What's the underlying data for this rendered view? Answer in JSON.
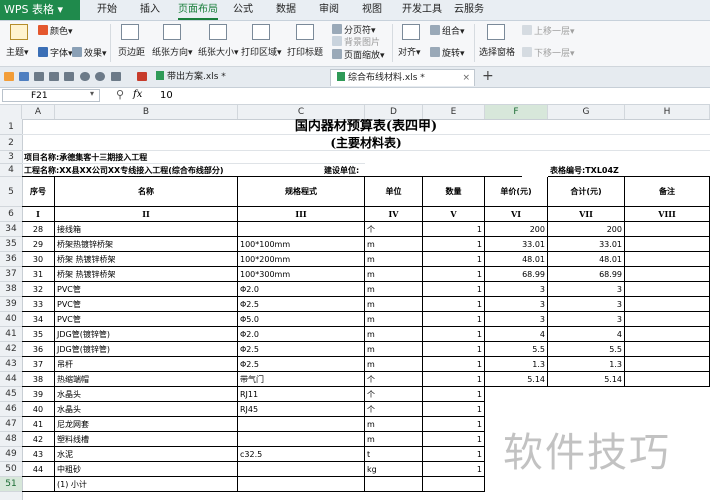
{
  "app_button": "WPS 表格",
  "ribbon_tabs": [
    "开始",
    "插入",
    "页面布局",
    "公式",
    "数据",
    "审阅",
    "视图",
    "开发工具",
    "云服务"
  ],
  "ribbon": {
    "theme": "主题",
    "colors": "颜色",
    "fonts": "字体",
    "effects": "效果",
    "margins": "页边距",
    "orientation": "纸张方向",
    "size": "纸张大小",
    "print_area": "打印区域",
    "print_titles": "打印标题",
    "page_break": "分页符",
    "bg_image": "背景图片",
    "page_zoom": "页面缩放",
    "align": "对齐",
    "group": "组合",
    "rotate": "旋转",
    "select_pane": "选择窗格",
    "bring_forward": "上移一层",
    "send_backward": "下移一层"
  },
  "doc_tabs": [
    {
      "label": "带出方案.xls *"
    },
    {
      "label": "综合布线材料.xls *"
    }
  ],
  "formula_bar": {
    "cell_ref": "F21",
    "fx": "fx",
    "value": "10"
  },
  "columns": [
    "A",
    "B",
    "C",
    "D",
    "E",
    "F",
    "G",
    "H"
  ],
  "row_numbers": [
    "1",
    "2",
    "3",
    "4",
    "5",
    "6",
    "34",
    "35",
    "36",
    "37",
    "38",
    "39",
    "40",
    "41",
    "42",
    "43",
    "44",
    "45",
    "46",
    "47",
    "48",
    "49",
    "50",
    "51"
  ],
  "sheet": {
    "title": "国内器材预算表(表四甲)",
    "subtitle": "(主要材料表)",
    "project_name": "项目名称:承德集客十三期接入工程",
    "work_name": "工程名称:XX县XX公司XX专线接入工程(综合布线部分)",
    "build_unit": "建设单位:",
    "table_no": "表格编号:TXL04Z",
    "headers": [
      "序号",
      "名称",
      "规格程式",
      "单位",
      "数量",
      "单价(元)",
      "合计(元)",
      "备注"
    ],
    "roman": [
      "I",
      "II",
      "III",
      "IV",
      "V",
      "VI",
      "VII",
      "VIII"
    ],
    "rows": [
      [
        "28",
        "接线箱",
        "",
        "个",
        "1",
        "200",
        "200",
        ""
      ],
      [
        "29",
        "桥架热镀锌桥架",
        "100*100mm",
        "m",
        "1",
        "33.01",
        "33.01",
        ""
      ],
      [
        "30",
        "桥架 热镀锌桥架",
        "100*200mm",
        "m",
        "1",
        "48.01",
        "48.01",
        ""
      ],
      [
        "31",
        "桥架 热镀锌桥架",
        "100*300mm",
        "m",
        "1",
        "68.99",
        "68.99",
        ""
      ],
      [
        "32",
        "PVC管",
        "Φ2.0",
        "m",
        "1",
        "3",
        "3",
        ""
      ],
      [
        "33",
        "PVC管",
        "Φ2.5",
        "m",
        "1",
        "3",
        "3",
        ""
      ],
      [
        "34",
        "PVC管",
        "Φ5.0",
        "m",
        "1",
        "3",
        "3",
        ""
      ],
      [
        "35",
        "JDG管(镀锌管)",
        "Φ2.0",
        "m",
        "1",
        "4",
        "4",
        ""
      ],
      [
        "36",
        "JDG管(镀锌管)",
        "Φ2.5",
        "m",
        "1",
        "5.5",
        "5.5",
        ""
      ],
      [
        "37",
        "吊杆",
        "Φ2.5",
        "m",
        "1",
        "1.3",
        "1.3",
        ""
      ],
      [
        "38",
        "热缩端帽",
        "带气门",
        "个",
        "1",
        "5.14",
        "5.14",
        ""
      ],
      [
        "39",
        "水晶头",
        "RJ11",
        "个",
        "1",
        "",
        "",
        ""
      ],
      [
        "40",
        "水晶头",
        "RJ45",
        "个",
        "1",
        "",
        "",
        ""
      ],
      [
        "41",
        "尼龙网套",
        "",
        "m",
        "1",
        "",
        "",
        ""
      ],
      [
        "42",
        "塑料线槽",
        "",
        "m",
        "1",
        "",
        "",
        ""
      ],
      [
        "43",
        "水泥",
        "c32.5",
        "t",
        "1",
        "",
        "",
        ""
      ],
      [
        "44",
        "中粗砂",
        "",
        "kg",
        "1",
        "",
        "",
        ""
      ],
      [
        "",
        "(1) 小计",
        "",
        "",
        "",
        "",
        "",
        ""
      ]
    ]
  },
  "watermark": "软件技巧"
}
